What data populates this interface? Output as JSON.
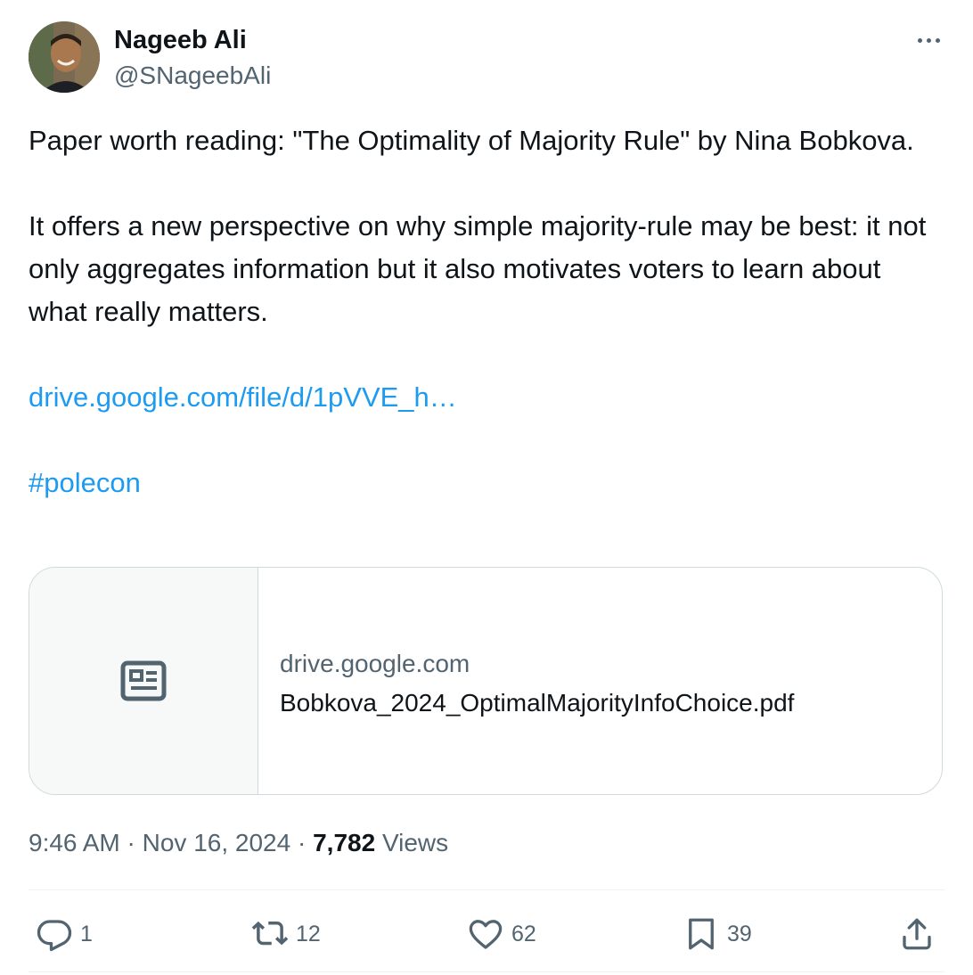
{
  "author": {
    "display_name": "Nageeb Ali",
    "handle": "@SNageebAli"
  },
  "tweet": {
    "line1": "Paper worth reading: \"The Optimality of Majority Rule\" by Nina Bobkova.",
    "line2": "It offers a new perspective on why simple majority-rule may be best: it not only aggregates information but it also motivates voters to learn about what really matters.",
    "link_text": "drive.google.com/file/d/1pVVE_h…",
    "hashtag": "#polecon"
  },
  "card": {
    "domain": "drive.google.com",
    "title": "Bobkova_2024_OptimalMajorityInfoChoice.pdf",
    "icon": "article-icon"
  },
  "meta": {
    "time": "9:46 AM",
    "separator": "·",
    "date": "Nov 16, 2024",
    "views_count": "7,782",
    "views_label": "Views"
  },
  "actions": {
    "reply_count": "1",
    "retweet_count": "12",
    "like_count": "62",
    "bookmark_count": "39"
  },
  "icons": {
    "more": "more-icon",
    "reply": "reply-icon",
    "retweet": "retweet-icon",
    "like": "heart-icon",
    "bookmark": "bookmark-icon",
    "share": "share-icon"
  },
  "colors": {
    "text": "#0f1419",
    "secondary": "#536471",
    "link": "#1d9bf0",
    "border": "#cfd9de",
    "card_bg": "#f7f9f9"
  }
}
